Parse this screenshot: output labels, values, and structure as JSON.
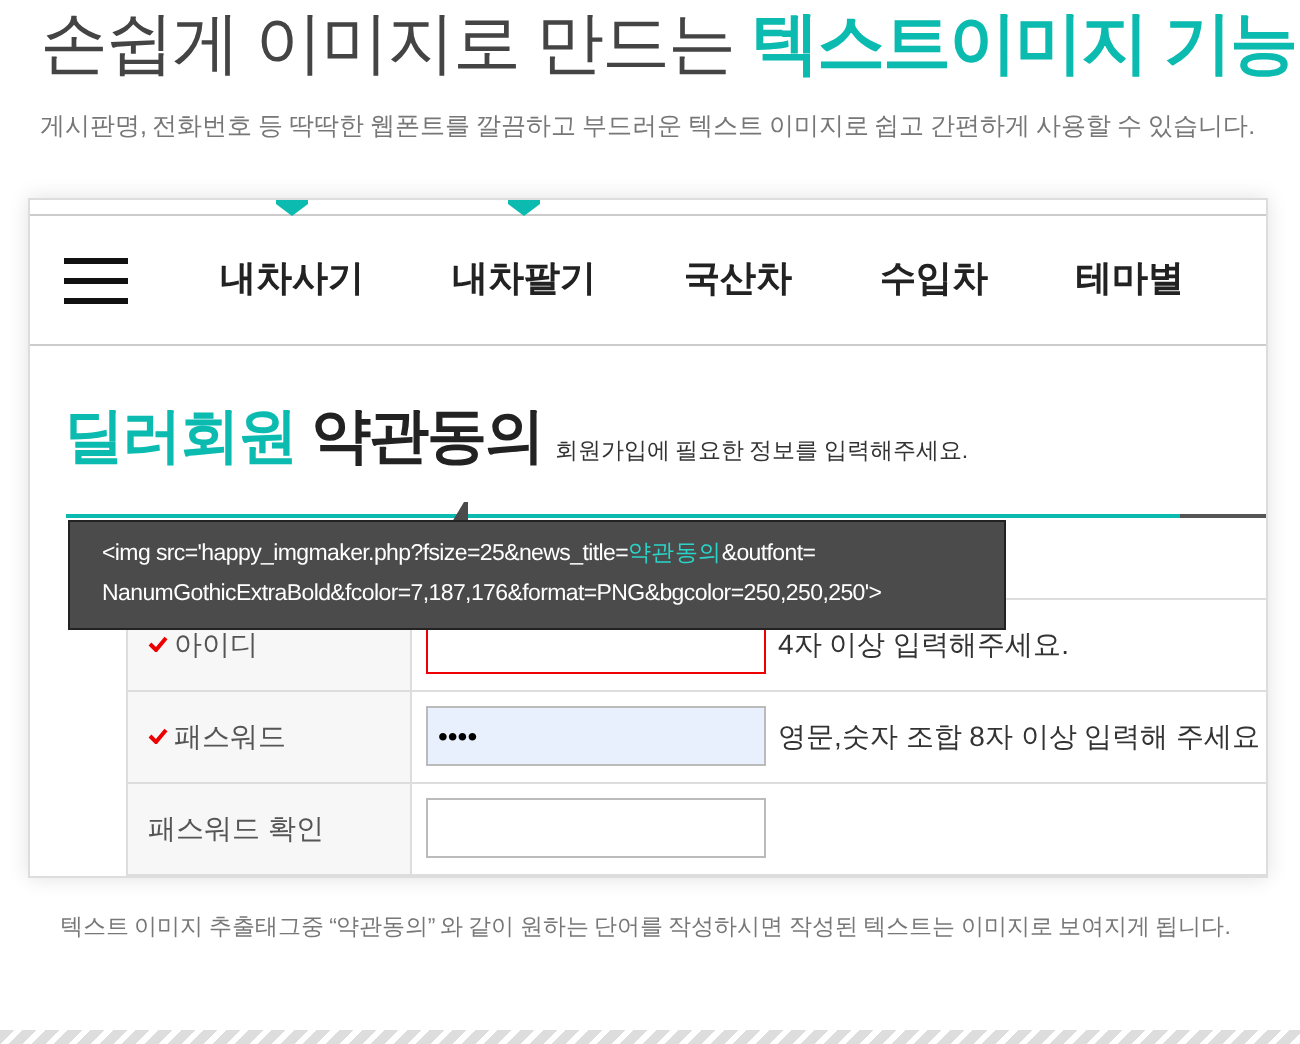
{
  "heading": {
    "plain": "손쉽게 이미지로 만드는",
    "accent": "텍스트이미지 기능"
  },
  "subtitle": "게시판명, 전화번호 등 딱딱한 웹폰트를 깔끔하고 부드러운 텍스트 이미지로 쉽고 간편하게 사용할 수 있습니다.",
  "preview": {
    "nav": [
      {
        "label": "내차사기",
        "marked": true
      },
      {
        "label": "내차팔기",
        "marked": true
      },
      {
        "label": "국산차",
        "marked": false
      },
      {
        "label": "수입차",
        "marked": false
      },
      {
        "label": "테마별",
        "marked": false
      }
    ],
    "title": {
      "accent": "딜러회원",
      "plain": "약관동의",
      "note": "회원가입에 필요한 정보를 입력해주세요."
    },
    "tooltip": {
      "before": "<img src='happy_imgmaker.php?fsize=25&news_title=",
      "highlight": "약관동의",
      "after": "&outfont= NanumGothicExtraBold&fcolor=7,187,176&format=PNG&bgcolor=250,250,250'>"
    },
    "form": [
      {
        "label": "아이디",
        "required": true,
        "invalid": true,
        "focused": false,
        "hint": "4자 이상 입력해주세요."
      },
      {
        "label": "패스워드",
        "required": true,
        "value": "••••",
        "invalid": false,
        "focused": true,
        "hint": "영문,숫자 조합 8자 이상 입력해 주세요"
      },
      {
        "label": "패스워드 확인",
        "required": false,
        "invalid": false,
        "focused": false
      }
    ]
  },
  "caption": "텍스트 이미지 추출태그중 “약관동의” 와 같이 원하는 단어를 작성하시면 작성된 텍스트는 이미지로 보여지게 됩니다."
}
